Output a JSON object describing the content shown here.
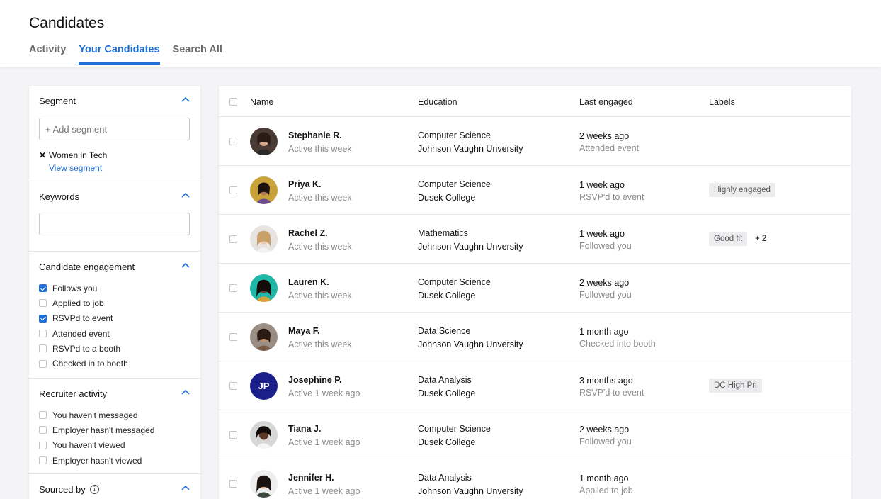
{
  "page": {
    "title": "Candidates",
    "tabs": [
      {
        "label": "Activity",
        "active": false
      },
      {
        "label": "Your Candidates",
        "active": true
      },
      {
        "label": "Search All",
        "active": false
      }
    ]
  },
  "filters": {
    "segment": {
      "title": "Segment",
      "placeholder": "+ Add segment",
      "applied": "Women in Tech",
      "view_link": "View segment"
    },
    "keywords": {
      "title": "Keywords",
      "value": ""
    },
    "engagement": {
      "title": "Candidate engagement",
      "options": [
        {
          "label": "Follows you",
          "checked": true
        },
        {
          "label": "Applied to job",
          "checked": false
        },
        {
          "label": "RSVPd to event",
          "checked": true
        },
        {
          "label": "Attended event",
          "checked": false
        },
        {
          "label": "RSVPd to a booth",
          "checked": false
        },
        {
          "label": "Checked in to booth",
          "checked": false
        }
      ]
    },
    "recruiter": {
      "title": "Recruiter activity",
      "options": [
        {
          "label": "You haven't messaged",
          "checked": false
        },
        {
          "label": "Employer hasn't messaged",
          "checked": false
        },
        {
          "label": "You haven't viewed",
          "checked": false
        },
        {
          "label": "Employer hasn't viewed",
          "checked": false
        }
      ]
    },
    "sourced": {
      "title": "Sourced by"
    }
  },
  "table": {
    "columns": {
      "name": "Name",
      "education": "Education",
      "engaged": "Last engaged",
      "labels": "Labels"
    },
    "rows": [
      {
        "name": "Stephanie R.",
        "activity": "Active this week",
        "major": "Computer Science",
        "school": "Johnson Vaughn Unversity",
        "engaged": "2 weeks ago",
        "event": "Attended event",
        "label": "",
        "more": ""
      },
      {
        "name": "Priya K.",
        "activity": "Active this week",
        "major": "Computer Science",
        "school": "Dusek College",
        "engaged": "1 week ago",
        "event": "RSVP'd to event",
        "label": "Highly engaged",
        "more": ""
      },
      {
        "name": "Rachel Z.",
        "activity": "Active this week",
        "major": "Mathematics",
        "school": "Johnson Vaughn Unversity",
        "engaged": "1 week ago",
        "event": "Followed you",
        "label": "Good fit",
        "more": "+ 2"
      },
      {
        "name": "Lauren K.",
        "activity": "Active this week",
        "major": "Computer Science",
        "school": "Dusek College",
        "engaged": "2 weeks ago",
        "event": "Followed you",
        "label": "",
        "more": ""
      },
      {
        "name": "Maya F.",
        "activity": "Active this week",
        "major": "Data Science",
        "school": "Johnson Vaughn Unversity",
        "engaged": "1 month ago",
        "event": "Checked into booth",
        "label": "",
        "more": ""
      },
      {
        "name": "Josephine P.",
        "activity": "Active 1 week ago",
        "major": "Data Analysis",
        "school": "Dusek College",
        "engaged": "3 months ago",
        "event": "RSVP'd to event",
        "label": "DC High Pri",
        "more": "",
        "initials": "JP"
      },
      {
        "name": "Tiana J.",
        "activity": "Active 1 week ago",
        "major": "Computer Science",
        "school": "Dusek College",
        "engaged": "2 weeks ago",
        "event": "Followed you",
        "label": "",
        "more": ""
      },
      {
        "name": "Jennifer H.",
        "activity": "Active 1 week ago",
        "major": "Data Analysis",
        "school": "Johnson Vaughn Unversity",
        "engaged": "1 month ago",
        "event": "Applied to job",
        "label": "",
        "more": ""
      }
    ]
  },
  "colors": {
    "accent": "#1f6fd6",
    "initials_avatar": "#1b1f8a"
  }
}
